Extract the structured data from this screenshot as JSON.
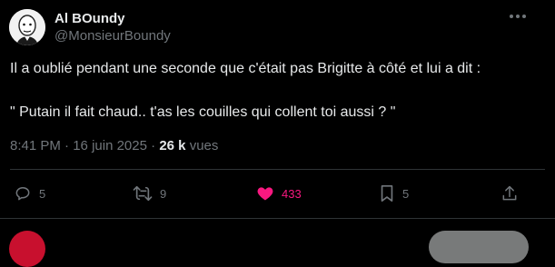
{
  "author": {
    "display_name": "Al BOundy",
    "handle": "@MonsieurBoundy"
  },
  "tweet": {
    "text_line_1": "Il a oublié pendant une seconde que c'était pas Brigitte à côté et lui a dit :",
    "text_line_2": "\" Putain il fait chaud.. t'as les couilles qui collent toi aussi ? \""
  },
  "meta": {
    "time": "8:41 PM",
    "separator": " · ",
    "date": "16 juin 2025",
    "views_count": "26 k",
    "views_label": "vues"
  },
  "actions": {
    "replies": "5",
    "retweets": "9",
    "likes": "433",
    "bookmarks": "5"
  },
  "icons": {
    "more": "more-icon",
    "reply": "reply-icon",
    "retweet": "retweet-icon",
    "like": "heart-icon",
    "bookmark": "bookmark-icon",
    "share": "share-icon"
  },
  "colors": {
    "background": "#000000",
    "text": "#e7e9ea",
    "muted": "#71767b",
    "like_active": "#f91880",
    "divider": "#2f3336"
  }
}
